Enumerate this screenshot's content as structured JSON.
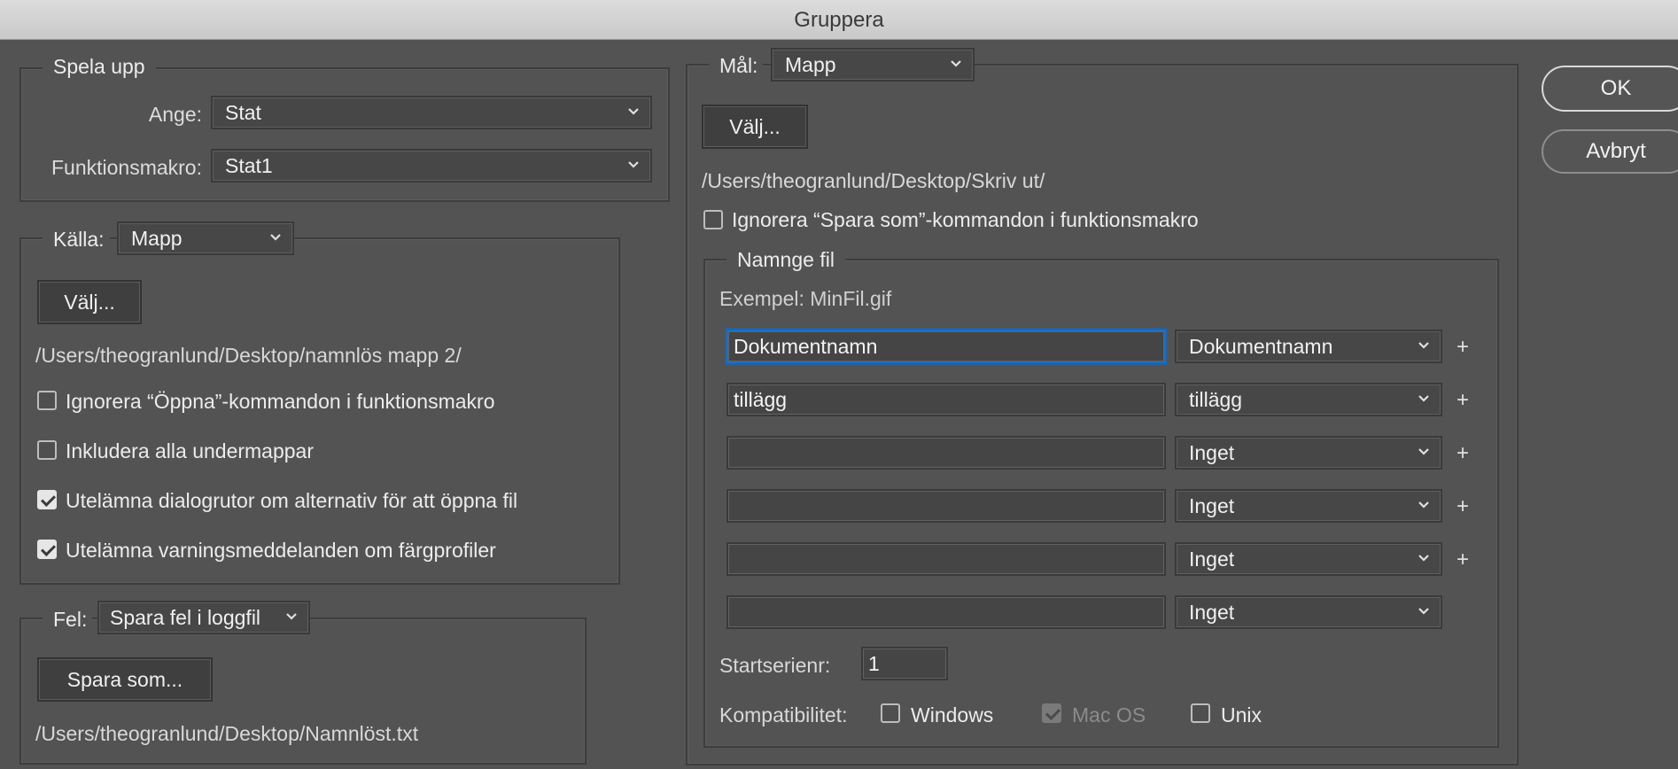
{
  "window": {
    "title": "Gruppera"
  },
  "play": {
    "legend": "Spela upp",
    "set_label": "Ange:",
    "set_value": "Stat",
    "action_label": "Funktionsmakro:",
    "action_value": "Stat1"
  },
  "source": {
    "label": "Källa:",
    "value": "Mapp",
    "choose_button": "Välj...",
    "path": "/Users/theogranlund/Desktop/namnlös mapp 2/",
    "options": [
      {
        "label": "Ignorera “Öppna”-kommandon i funktionsmakro",
        "checked": false
      },
      {
        "label": "Inkludera alla undermappar",
        "checked": false
      },
      {
        "label": "Utelämna dialogrutor om alternativ för att öppna fil",
        "checked": true
      },
      {
        "label": "Utelämna varningsmeddelanden om färgprofiler",
        "checked": true
      }
    ]
  },
  "errors": {
    "label": "Fel:",
    "value": "Spara fel i loggfil",
    "save_as_button": "Spara som...",
    "path": "/Users/theogranlund/Desktop/Namnlöst.txt"
  },
  "destination": {
    "label": "Mål:",
    "value": "Mapp",
    "choose_button": "Välj...",
    "path": "/Users/theogranlund/Desktop/Skriv ut/",
    "ignore_save_as": {
      "label": "Ignorera “Spara som”-kommandon i funktionsmakro",
      "checked": false
    }
  },
  "naming": {
    "legend": "Namnge fil",
    "example": "Exempel: MinFil.gif",
    "rows": [
      {
        "text": "Dokumentnamn",
        "select": "Dokumentnamn",
        "plus": "+"
      },
      {
        "text": "tillägg",
        "select": "tillägg",
        "plus": "+"
      },
      {
        "text": "",
        "select": "Inget",
        "plus": "+"
      },
      {
        "text": "",
        "select": "Inget",
        "plus": "+"
      },
      {
        "text": "",
        "select": "Inget",
        "plus": "+"
      },
      {
        "text": "",
        "select": "Inget",
        "plus": ""
      }
    ],
    "serial_label": "Startserienr:",
    "serial_value": "1",
    "compat_label": "Kompatibilitet:",
    "compat": [
      {
        "label": "Windows",
        "checked": false,
        "disabled": false
      },
      {
        "label": "Mac OS",
        "checked": true,
        "disabled": true
      },
      {
        "label": "Unix",
        "checked": false,
        "disabled": false
      }
    ]
  },
  "buttons": {
    "ok": "OK",
    "cancel": "Avbryt"
  }
}
